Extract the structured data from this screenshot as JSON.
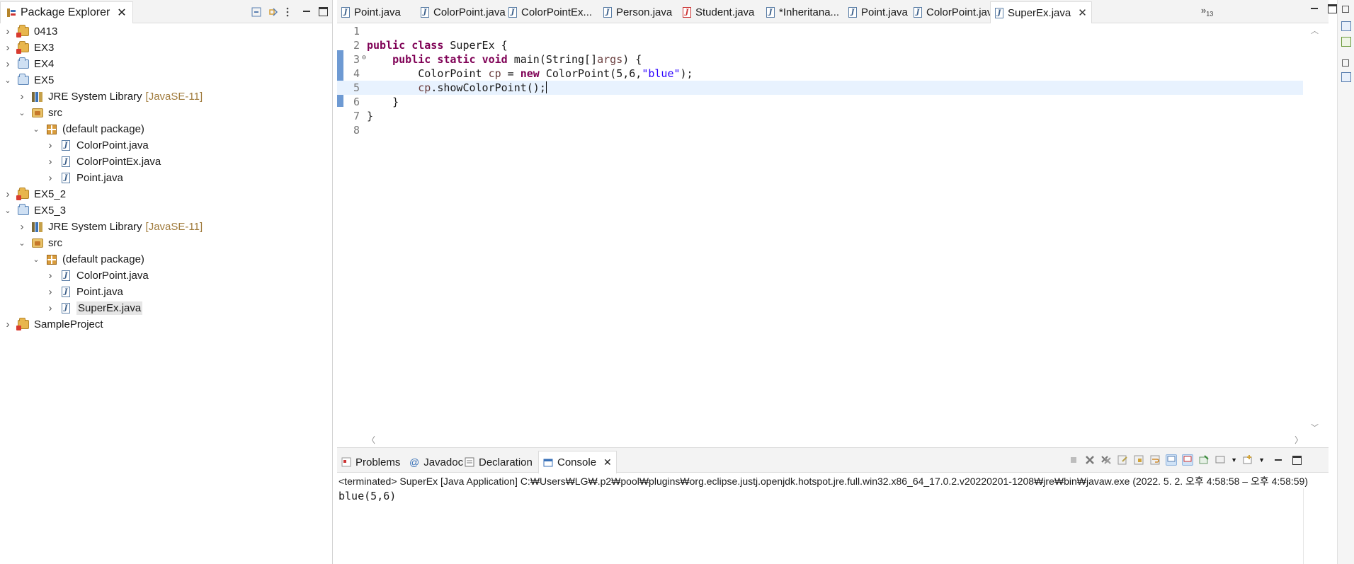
{
  "package_explorer": {
    "title": "Package Explorer",
    "tree": [
      {
        "label": "0413",
        "level": 0,
        "expanded": false,
        "icon": "project-error-icon"
      },
      {
        "label": "EX3",
        "level": 0,
        "expanded": false,
        "icon": "project-error-icon"
      },
      {
        "label": "EX4",
        "level": 0,
        "expanded": false,
        "icon": "java-project-icon"
      },
      {
        "label": "EX5",
        "level": 0,
        "expanded": true,
        "icon": "java-project-icon"
      },
      {
        "label": "JRE System Library",
        "decoration": "[JavaSE-11]",
        "level": 1,
        "expanded": false,
        "icon": "library-icon"
      },
      {
        "label": "src",
        "level": 1,
        "expanded": true,
        "icon": "source-folder-icon"
      },
      {
        "label": "(default package)",
        "level": 2,
        "expanded": true,
        "icon": "package-icon"
      },
      {
        "label": "ColorPoint.java",
        "level": 3,
        "expanded": false,
        "icon": "java-file-icon"
      },
      {
        "label": "ColorPointEx.java",
        "level": 3,
        "expanded": false,
        "icon": "java-file-icon"
      },
      {
        "label": "Point.java",
        "level": 3,
        "expanded": false,
        "icon": "java-file-icon"
      },
      {
        "label": "EX5_2",
        "level": 0,
        "expanded": false,
        "icon": "project-error-icon"
      },
      {
        "label": "EX5_3",
        "level": 0,
        "expanded": true,
        "icon": "java-project-icon"
      },
      {
        "label": "JRE System Library",
        "decoration": "[JavaSE-11]",
        "level": 1,
        "expanded": false,
        "icon": "library-icon"
      },
      {
        "label": "src",
        "level": 1,
        "expanded": true,
        "icon": "source-folder-icon"
      },
      {
        "label": "(default package)",
        "level": 2,
        "expanded": true,
        "icon": "package-icon"
      },
      {
        "label": "ColorPoint.java",
        "level": 3,
        "expanded": false,
        "icon": "java-file-icon"
      },
      {
        "label": "Point.java",
        "level": 3,
        "expanded": false,
        "icon": "java-file-icon"
      },
      {
        "label": "SuperEx.java",
        "level": 3,
        "expanded": false,
        "icon": "java-file-icon",
        "selected": true
      },
      {
        "label": "SampleProject",
        "level": 0,
        "expanded": false,
        "icon": "project-error-icon"
      }
    ]
  },
  "editor": {
    "tabs": [
      {
        "label": "Point.java",
        "icon": "java-file-icon",
        "active": false
      },
      {
        "label": "ColorPoint.java",
        "icon": "java-file-icon",
        "active": false
      },
      {
        "label": "ColorPointEx...",
        "icon": "java-file-icon",
        "active": false
      },
      {
        "label": "Person.java",
        "icon": "java-file-icon",
        "active": false
      },
      {
        "label": "Student.java",
        "icon": "java-file-error-icon",
        "active": false
      },
      {
        "label": "*Inheritana...",
        "icon": "java-file-icon",
        "active": false
      },
      {
        "label": "Point.java",
        "icon": "java-file-icon",
        "active": false
      },
      {
        "label": "ColorPoint.java",
        "icon": "java-file-icon",
        "active": false
      },
      {
        "label": "SuperEx.java",
        "icon": "java-file-icon",
        "active": true
      }
    ],
    "overflow": {
      "glyph": "»",
      "count": "13"
    },
    "current_line": 5,
    "lines": [
      {
        "num": "1",
        "tokens": []
      },
      {
        "num": "2",
        "tokens": [
          {
            "t": "public",
            "c": "kw"
          },
          {
            "t": " "
          },
          {
            "t": "class",
            "c": "kw"
          },
          {
            "t": " SuperEx {"
          }
        ]
      },
      {
        "num": "3",
        "fold": "⊖",
        "tokens": [
          {
            "t": "    "
          },
          {
            "t": "public",
            "c": "kw"
          },
          {
            "t": " "
          },
          {
            "t": "static",
            "c": "kw"
          },
          {
            "t": " "
          },
          {
            "t": "void",
            "c": "kw"
          },
          {
            "t": " main(String[]"
          },
          {
            "t": "args",
            "c": "var"
          },
          {
            "t": ") {"
          }
        ]
      },
      {
        "num": "4",
        "tokens": [
          {
            "t": "        ColorPoint "
          },
          {
            "t": "cp",
            "c": "var"
          },
          {
            "t": " = "
          },
          {
            "t": "new",
            "c": "kw"
          },
          {
            "t": " ColorPoint(5,6,"
          },
          {
            "t": "\"blue\"",
            "c": "str"
          },
          {
            "t": ");"
          }
        ]
      },
      {
        "num": "5",
        "tokens": [
          {
            "t": "        "
          },
          {
            "t": "cp",
            "c": "var"
          },
          {
            "t": ".showColorPoint();"
          }
        ],
        "caret": true
      },
      {
        "num": "6",
        "tokens": [
          {
            "t": "    }"
          }
        ]
      },
      {
        "num": "7",
        "tokens": [
          {
            "t": "}"
          }
        ]
      },
      {
        "num": "8",
        "tokens": []
      }
    ]
  },
  "console": {
    "tabs": [
      {
        "label": "Problems",
        "icon": "problems-icon",
        "active": false
      },
      {
        "label": "Javadoc",
        "icon": "javadoc-icon",
        "active": false
      },
      {
        "label": "Declaration",
        "icon": "declaration-icon",
        "active": false
      },
      {
        "label": "Console",
        "icon": "console-icon",
        "active": true
      }
    ],
    "status": "<terminated> SuperEx [Java Application] C:₩Users₩LG₩.p2₩pool₩plugins₩org.eclipse.justj.openjdk.hotspot.jre.full.win32.x86_64_17.0.2.v20220201-1208₩jre₩bin₩javaw.exe  (2022. 5. 2. 오후 4:58:58 – 오후 4:58:59)",
    "output": "blue(5,6)"
  },
  "colors": {
    "keyword": "#7f0055",
    "string": "#2a00ff",
    "local_var": "#6a3e3e",
    "current_line_bg": "#e8f2fe",
    "decoration": "#a07b3c",
    "gutter_change": "#6e9ad3"
  }
}
